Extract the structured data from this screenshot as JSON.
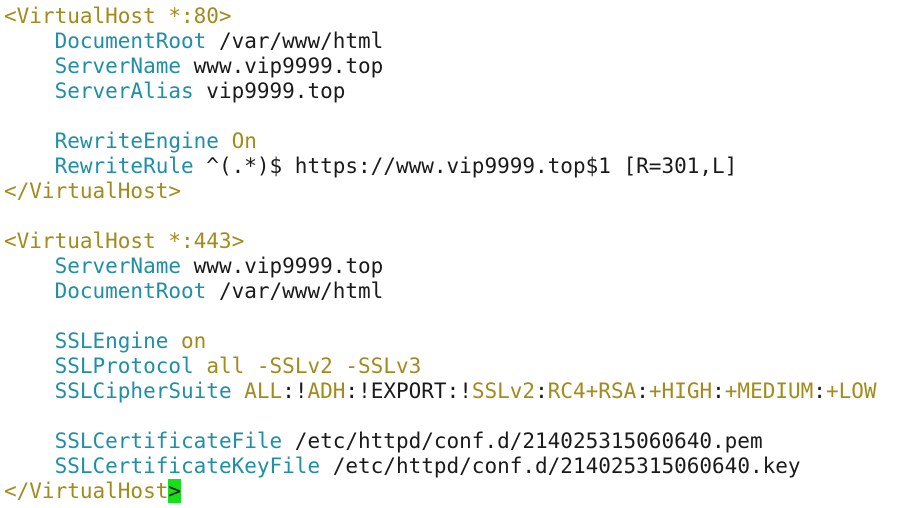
{
  "editor": {
    "colors": {
      "tag": "#a38a1c",
      "directive": "#1f8fa8",
      "value": "#1a1a1a",
      "keyword": "#a38a1c",
      "cursor": "#16e01a"
    },
    "lines": [
      [
        {
          "t": "<VirtualHost *:80>",
          "c": "tag"
        }
      ],
      [
        {
          "t": "    ",
          "c": "val"
        },
        {
          "t": "DocumentRoot",
          "c": "dir"
        },
        {
          "t": " /var/www/html",
          "c": "val"
        }
      ],
      [
        {
          "t": "    ",
          "c": "val"
        },
        {
          "t": "ServerName",
          "c": "dir"
        },
        {
          "t": " www.vip9999.top",
          "c": "val"
        }
      ],
      [
        {
          "t": "    ",
          "c": "val"
        },
        {
          "t": "ServerAlias",
          "c": "dir"
        },
        {
          "t": " vip9999.top",
          "c": "val"
        }
      ],
      [],
      [
        {
          "t": "    ",
          "c": "val"
        },
        {
          "t": "RewriteEngine",
          "c": "dir"
        },
        {
          "t": " ",
          "c": "val"
        },
        {
          "t": "On",
          "c": "kw"
        }
      ],
      [
        {
          "t": "    ",
          "c": "val"
        },
        {
          "t": "RewriteRule",
          "c": "dir"
        },
        {
          "t": " ^(.*)$ https://www.vip9999.top$1 [R=301,L]",
          "c": "val"
        }
      ],
      [
        {
          "t": "</VirtualHost>",
          "c": "tag"
        }
      ],
      [],
      [
        {
          "t": "<VirtualHost *:443>",
          "c": "tag"
        }
      ],
      [
        {
          "t": "    ",
          "c": "val"
        },
        {
          "t": "ServerName",
          "c": "dir"
        },
        {
          "t": " www.vip9999.top",
          "c": "val"
        }
      ],
      [
        {
          "t": "    ",
          "c": "val"
        },
        {
          "t": "DocumentRoot",
          "c": "dir"
        },
        {
          "t": " /var/www/html",
          "c": "val"
        }
      ],
      [],
      [
        {
          "t": "    ",
          "c": "val"
        },
        {
          "t": "SSLEngine",
          "c": "dir"
        },
        {
          "t": " ",
          "c": "val"
        },
        {
          "t": "on",
          "c": "kw"
        }
      ],
      [
        {
          "t": "    ",
          "c": "val"
        },
        {
          "t": "SSLProtocol",
          "c": "dir"
        },
        {
          "t": " ",
          "c": "val"
        },
        {
          "t": "all -SSLv2 -SSLv3",
          "c": "kw"
        }
      ],
      [
        {
          "t": "    ",
          "c": "val"
        },
        {
          "t": "SSLCipherSuite",
          "c": "dir"
        },
        {
          "t": " ",
          "c": "val"
        },
        {
          "t": "ALL",
          "c": "kw"
        },
        {
          "t": ":!",
          "c": "val"
        },
        {
          "t": "ADH",
          "c": "kw"
        },
        {
          "t": ":!EXPORT:!",
          "c": "val"
        },
        {
          "t": "SSLv2",
          "c": "kw"
        },
        {
          "t": ":",
          "c": "val"
        },
        {
          "t": "RC4+RSA",
          "c": "kw"
        },
        {
          "t": ":",
          "c": "val"
        },
        {
          "t": "+HIGH",
          "c": "kw"
        },
        {
          "t": ":",
          "c": "val"
        },
        {
          "t": "+MEDIUM",
          "c": "kw"
        },
        {
          "t": ":",
          "c": "val"
        },
        {
          "t": "+LOW",
          "c": "kw"
        }
      ],
      [],
      [
        {
          "t": "    ",
          "c": "val"
        },
        {
          "t": "SSLCertificateFile",
          "c": "dir"
        },
        {
          "t": " /etc/httpd/conf.d/214025315060640.pem",
          "c": "val"
        }
      ],
      [
        {
          "t": "    ",
          "c": "val"
        },
        {
          "t": "SSLCertificateKeyFile",
          "c": "dir"
        },
        {
          "t": " /etc/httpd/conf.d/214025315060640.key",
          "c": "val"
        }
      ],
      [
        {
          "t": "</VirtualHost",
          "c": "tag"
        },
        {
          "t": ">",
          "c": "cursor"
        }
      ]
    ]
  }
}
